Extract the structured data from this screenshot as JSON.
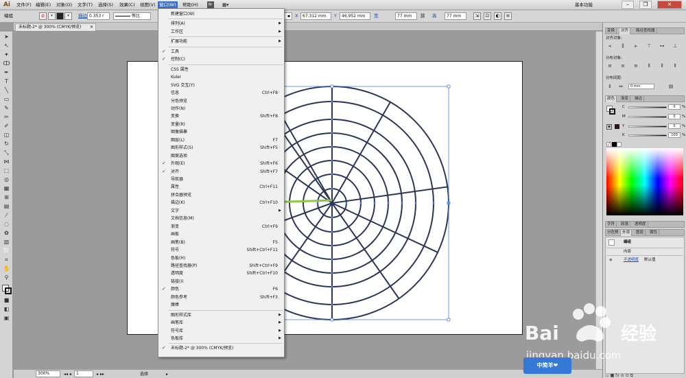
{
  "app": {
    "logo": "Ai",
    "workspace": "基本功能",
    "win_min": "–",
    "win_max": "❐",
    "win_close": "✕"
  },
  "menubar": {
    "items": [
      "文件(F)",
      "编辑(E)",
      "对象(O)",
      "文字(T)",
      "选择(S)",
      "效果(C)",
      "视图(V)",
      "窗口(W)",
      "帮助(H)"
    ],
    "bridge": "Br"
  },
  "controlbar": {
    "title": "编组",
    "stroke_label": "描边",
    "stroke_value": "0.353 r",
    "style_label": "等比",
    "x_label": "X",
    "x_value": "67.312 mm",
    "y_label": "Y",
    "y_value": "46.952 mm",
    "w_label": "宽",
    "w_value": "77 mm",
    "h_label": "高",
    "h_value": "77 mm"
  },
  "document": {
    "tab_title": "未标题-2* @ 300% (CMYK/预览)",
    "zoom": "300%",
    "page": "1",
    "status": "选择"
  },
  "window_menu": {
    "items": [
      {
        "label": "新建窗口(W)",
        "shortcut": "",
        "checked": false,
        "submenu": false,
        "sep_after": true
      },
      {
        "label": "排列(A)",
        "shortcut": "",
        "checked": false,
        "submenu": true,
        "sep_after": false
      },
      {
        "label": "工作区",
        "shortcut": "",
        "checked": false,
        "submenu": true,
        "sep_after": true
      },
      {
        "label": "扩展功能",
        "shortcut": "",
        "checked": false,
        "submenu": true,
        "sep_after": true
      },
      {
        "label": "工具",
        "shortcut": "",
        "checked": true,
        "submenu": false,
        "sep_after": false
      },
      {
        "label": "控制(C)",
        "shortcut": "",
        "checked": true,
        "submenu": false,
        "sep_after": true
      },
      {
        "label": "CSS 属性",
        "shortcut": "",
        "checked": false,
        "submenu": false,
        "sep_after": false
      },
      {
        "label": "Kuler",
        "shortcut": "",
        "checked": false,
        "submenu": false,
        "sep_after": false
      },
      {
        "label": "SVG 交互(Y)",
        "shortcut": "",
        "checked": false,
        "submenu": false,
        "sep_after": false
      },
      {
        "label": "信息",
        "shortcut": "Ctrl+F8",
        "checked": false,
        "submenu": false,
        "sep_after": false
      },
      {
        "label": "分色预览",
        "shortcut": "",
        "checked": false,
        "submenu": false,
        "sep_after": false
      },
      {
        "label": "动作(N)",
        "shortcut": "",
        "checked": false,
        "submenu": false,
        "sep_after": false
      },
      {
        "label": "变换",
        "shortcut": "Shift+F8",
        "checked": false,
        "submenu": false,
        "sep_after": false
      },
      {
        "label": "变量(R)",
        "shortcut": "",
        "checked": false,
        "submenu": false,
        "sep_after": false
      },
      {
        "label": "图像描摹",
        "shortcut": "",
        "checked": false,
        "submenu": false,
        "sep_after": false
      },
      {
        "label": "图层(L)",
        "shortcut": "F7",
        "checked": false,
        "submenu": false,
        "sep_after": false
      },
      {
        "label": "图形样式(S)",
        "shortcut": "Shift+F5",
        "checked": false,
        "submenu": false,
        "sep_after": false
      },
      {
        "label": "图案选项",
        "shortcut": "",
        "checked": false,
        "submenu": false,
        "sep_after": false
      },
      {
        "label": "外观(E)",
        "shortcut": "Shift+F6",
        "checked": true,
        "submenu": false,
        "sep_after": false
      },
      {
        "label": "对齐",
        "shortcut": "Shift+F7",
        "checked": true,
        "submenu": false,
        "sep_after": false
      },
      {
        "label": "导航器",
        "shortcut": "",
        "checked": false,
        "submenu": false,
        "sep_after": false
      },
      {
        "label": "属性",
        "shortcut": "Ctrl+F11",
        "checked": false,
        "submenu": false,
        "sep_after": false
      },
      {
        "label": "拼合器预览",
        "shortcut": "",
        "checked": false,
        "submenu": false,
        "sep_after": false
      },
      {
        "label": "描边(K)",
        "shortcut": "Ctrl+F10",
        "checked": false,
        "submenu": false,
        "sep_after": false
      },
      {
        "label": "文字",
        "shortcut": "",
        "checked": false,
        "submenu": true,
        "sep_after": false
      },
      {
        "label": "文档信息(M)",
        "shortcut": "",
        "checked": false,
        "submenu": false,
        "sep_after": false
      },
      {
        "label": "渐变",
        "shortcut": "Ctrl+F9",
        "checked": false,
        "submenu": false,
        "sep_after": false
      },
      {
        "label": "画板",
        "shortcut": "",
        "checked": false,
        "submenu": false,
        "sep_after": false
      },
      {
        "label": "画笔(B)",
        "shortcut": "F5",
        "checked": false,
        "submenu": false,
        "sep_after": false
      },
      {
        "label": "符号",
        "shortcut": "Shift+Ctrl+F11",
        "checked": false,
        "submenu": false,
        "sep_after": false
      },
      {
        "label": "色板(H)",
        "shortcut": "",
        "checked": false,
        "submenu": false,
        "sep_after": false
      },
      {
        "label": "路径查找器(P)",
        "shortcut": "Shift+Ctrl+F9",
        "checked": false,
        "submenu": false,
        "sep_after": false
      },
      {
        "label": "透明度",
        "shortcut": "Shift+Ctrl+F10",
        "checked": false,
        "submenu": false,
        "sep_after": false
      },
      {
        "label": "链接(I)",
        "shortcut": "",
        "checked": false,
        "submenu": false,
        "sep_after": false
      },
      {
        "label": "颜色",
        "shortcut": "F6",
        "checked": true,
        "submenu": false,
        "sep_after": false
      },
      {
        "label": "颜色参考",
        "shortcut": "Shift+F3",
        "checked": false,
        "submenu": false,
        "sep_after": false
      },
      {
        "label": "魔棒",
        "shortcut": "",
        "checked": false,
        "submenu": false,
        "sep_after": true
      },
      {
        "label": "图形样式库",
        "shortcut": "",
        "checked": false,
        "submenu": true,
        "sep_after": false
      },
      {
        "label": "画笔库",
        "shortcut": "",
        "checked": false,
        "submenu": true,
        "sep_after": false
      },
      {
        "label": "符号库",
        "shortcut": "",
        "checked": false,
        "submenu": true,
        "sep_after": false
      },
      {
        "label": "色板库",
        "shortcut": "",
        "checked": false,
        "submenu": true,
        "sep_after": true
      },
      {
        "label": "未标题-2* @ 300% (CMYK/预览)",
        "shortcut": "",
        "checked": true,
        "submenu": false,
        "sep_after": false
      }
    ]
  },
  "panels": {
    "align_tabs": [
      "变换",
      "对齐",
      "路径查找器"
    ],
    "align_objects": "对齐对象:",
    "distribute_objects": "分布对象:",
    "distribute_spacing": "分布间距:",
    "spacing_value": "0 mm",
    "color_tabs": [
      "颜色",
      "渐变",
      "描边"
    ],
    "color_channels": [
      {
        "key": "C",
        "value": "0"
      },
      {
        "key": "M",
        "value": "0"
      },
      {
        "key": "Y",
        "value": "0"
      },
      {
        "key": "K",
        "value": "100"
      }
    ],
    "percent": "%",
    "char_tabs": [
      "字符",
      "段落",
      "透明度"
    ],
    "appearance_tabs": [
      "分色预",
      "外观",
      "图层",
      "属性"
    ],
    "appearance_rows": [
      {
        "label": "编组",
        "value": ""
      },
      {
        "label": "内容",
        "value": ""
      },
      {
        "label": "不透明度",
        "value": "默认值"
      }
    ]
  },
  "watermark": {
    "brand": "Bai",
    "brand2": "经验",
    "url": "jingyan.baidu.com",
    "badge": "中简羊❤"
  },
  "colors": {
    "circle_stroke": "#2b3657",
    "arrow": "#8dc63f",
    "selection": "#4a7fe0"
  }
}
